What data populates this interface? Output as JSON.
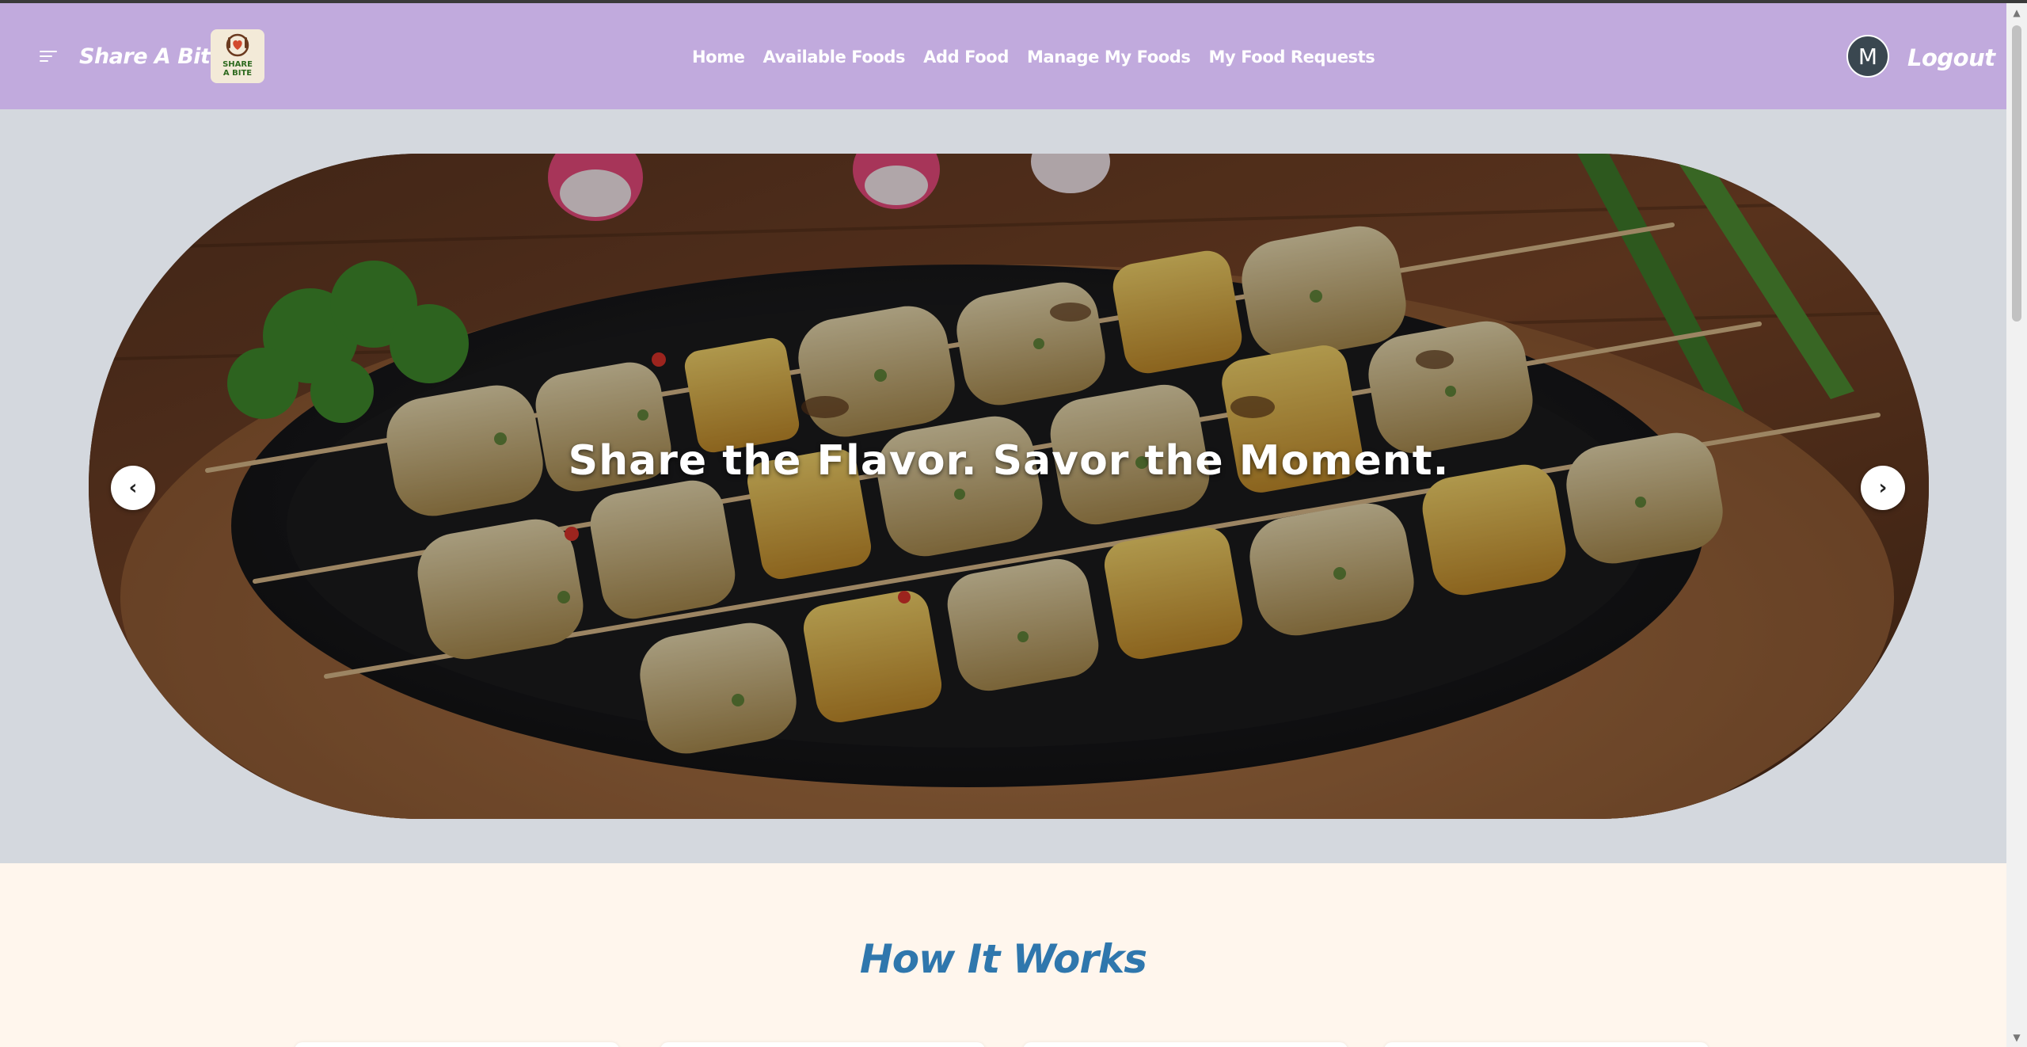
{
  "brand": {
    "name": "Share A Bite",
    "logo_line1": "SHARE",
    "logo_line2": "A BITE"
  },
  "nav": {
    "items": [
      {
        "label": "Home"
      },
      {
        "label": "Available Foods"
      },
      {
        "label": "Add Food"
      },
      {
        "label": "Manage My Foods"
      },
      {
        "label": "My Food Requests"
      }
    ]
  },
  "user": {
    "avatar_initial": "M",
    "logout_label": "Logout"
  },
  "hero": {
    "caption": "Share the Flavor. Savor the Moment.",
    "prev_glyph": "‹",
    "next_glyph": "›"
  },
  "how_it_works": {
    "title": "How It Works"
  },
  "icons": {
    "menu": "hamburger-menu-icon",
    "prev": "chevron-left-icon",
    "next": "chevron-right-icon"
  },
  "colors": {
    "navbar": "#c1aadd",
    "hero_bg": "#d4d8de",
    "section_bg": "#fff6ed",
    "title": "#2f77ad"
  }
}
